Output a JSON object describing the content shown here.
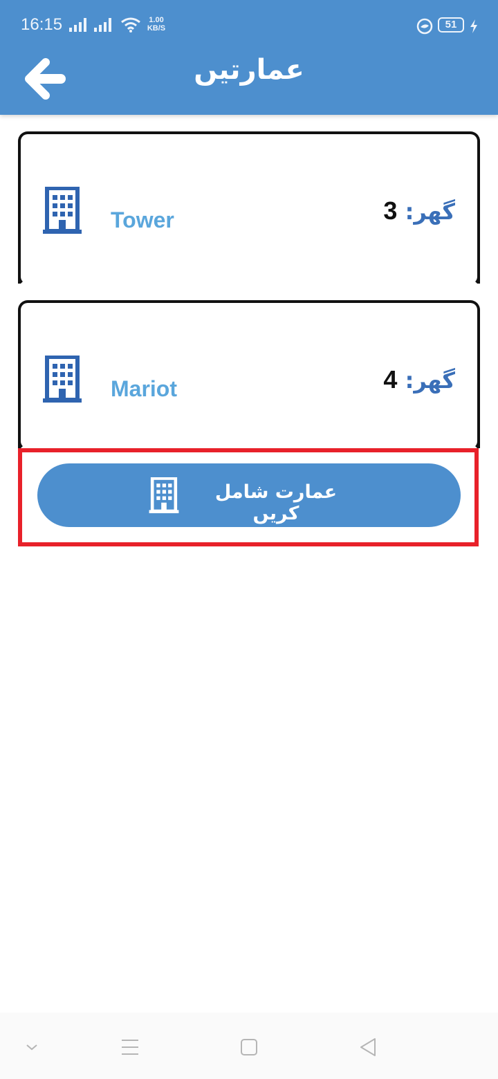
{
  "status_bar": {
    "time": "16:15",
    "net_speed_value": "1.00",
    "net_speed_unit": "KB/S",
    "battery_level": "51"
  },
  "header": {
    "title": "عمارتیں",
    "back_icon": "arrow-left-icon"
  },
  "buildings": [
    {
      "name": "Tower",
      "count_label": "گھر:",
      "count_value": "3",
      "icon": "building-icon"
    },
    {
      "name": "Mariot",
      "count_label": "گھر:",
      "count_value": "4",
      "icon": "building-icon"
    }
  ],
  "add_button": {
    "label": "عمارت شامل کریں",
    "icon": "building-icon"
  },
  "colors": {
    "primary": "#4d8fce",
    "name_text": "#5aa6dc",
    "icon_blue": "#2f64b0",
    "highlight": "#e8212a"
  },
  "nav_bar": {
    "icons": [
      "chevron-down-icon",
      "menu-icon",
      "home-square-icon",
      "back-triangle-icon"
    ]
  }
}
